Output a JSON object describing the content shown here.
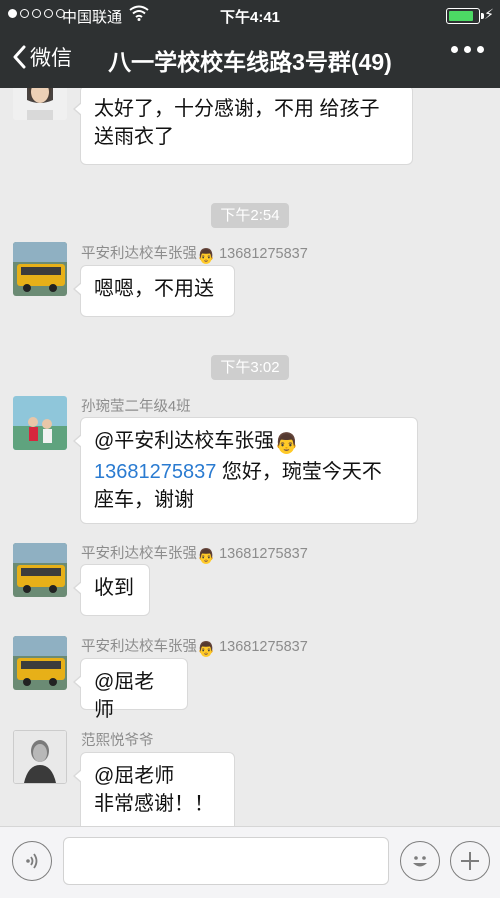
{
  "status": {
    "carrier": "中国联通",
    "time": "下午4:41"
  },
  "nav": {
    "back_label": "微信",
    "title": "八一学校校车线路3号群(49)"
  },
  "messages": [
    {
      "sender": "",
      "text": "太好了，十分感谢，不用 给孩子\n送雨衣了"
    },
    {
      "timestamp": "下午2:54"
    },
    {
      "sender_name": "平安利达校车张强",
      "sender_phone": "13681275837",
      "text": "嗯嗯，不用送"
    },
    {
      "timestamp": "下午3:02"
    },
    {
      "sender_name": "孙琬莹二年级4班",
      "mention": "@平安利达校车张强",
      "phone_link": "13681275837",
      "text_after_link": " 您好，琬莹今天不",
      "text_line3": "座车，谢谢"
    },
    {
      "sender_name": "平安利达校车张强",
      "sender_phone": "13681275837",
      "text": "收到"
    },
    {
      "sender_name": "平安利达校车张强",
      "sender_phone": "13681275837",
      "text": "@屈老师"
    },
    {
      "sender_name": "范熙悦爷爷",
      "text_line1": "@屈老师",
      "text_line2": "非常感谢！！"
    }
  ],
  "icons": {
    "back": "chevron-left-icon",
    "more": "more-icon",
    "voice": "voice-icon",
    "emoji": "emoji-icon",
    "add": "plus-icon"
  },
  "colors": {
    "nav_bg": "#2e3132",
    "chat_bg": "#ebebeb",
    "link": "#2a7bd1",
    "battery": "#4cd964"
  }
}
